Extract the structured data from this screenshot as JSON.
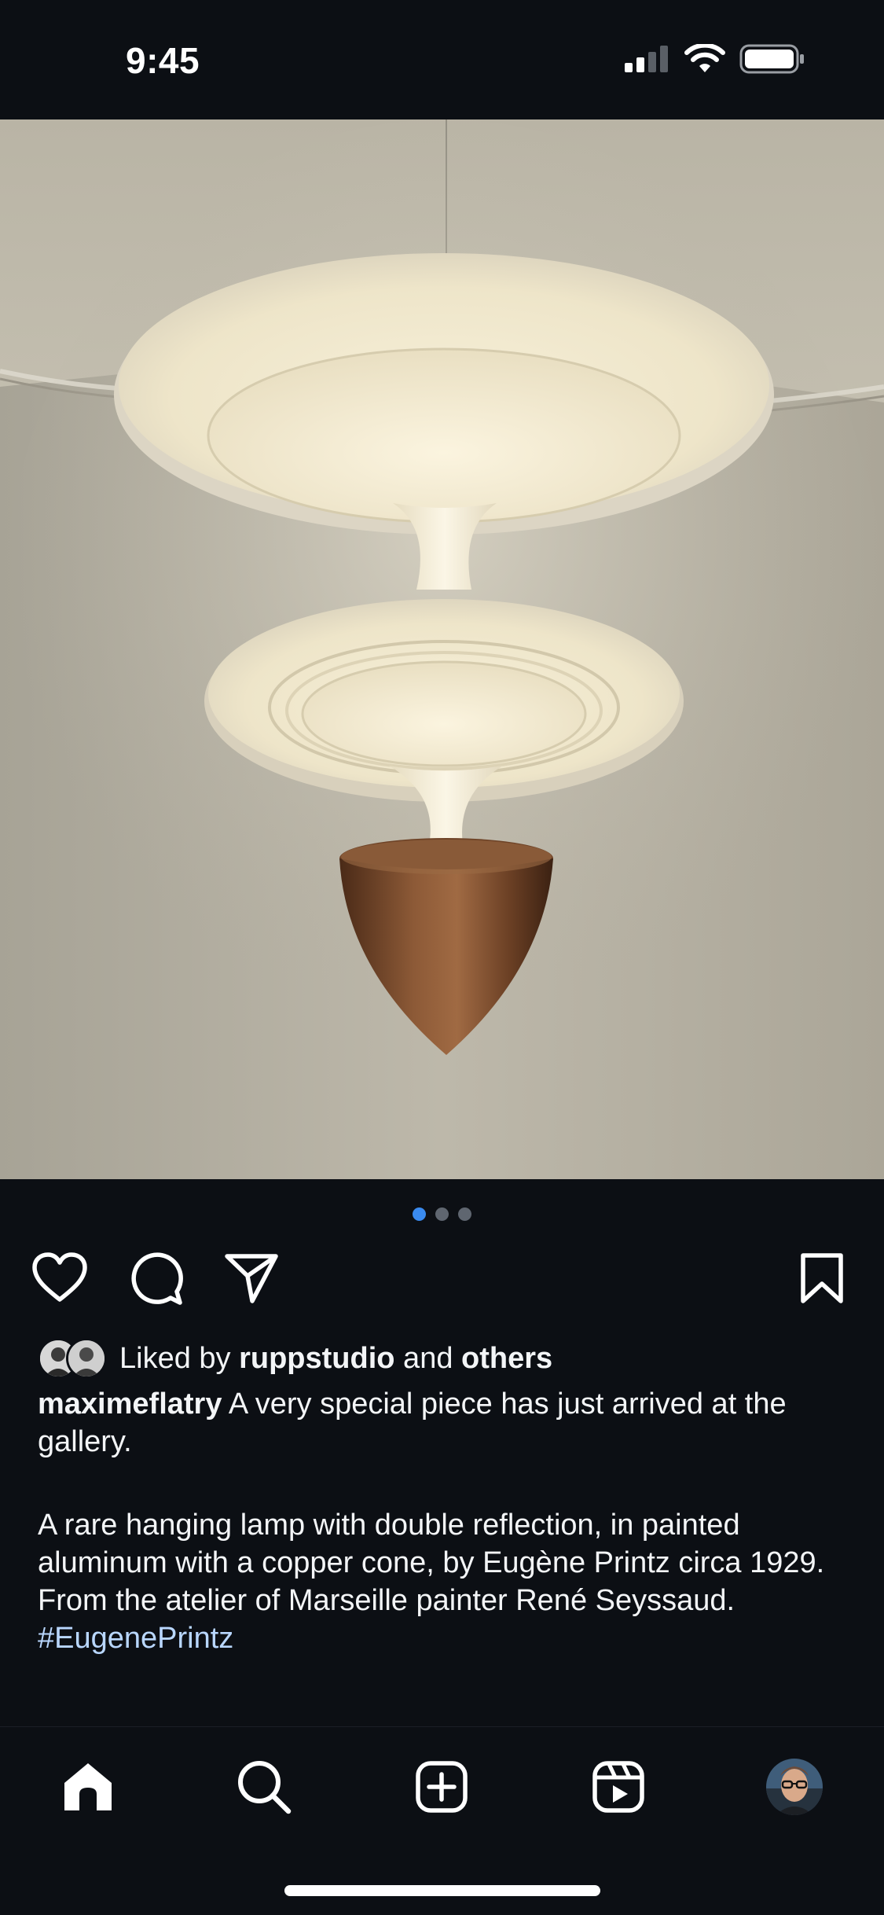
{
  "status_bar": {
    "time": "9:45"
  },
  "post": {
    "carousel": {
      "count": 3,
      "active_index": 0
    },
    "likes": {
      "prefix": "Liked by ",
      "first_user": "ruppstudio",
      "connector": " and ",
      "others": "others"
    },
    "caption": {
      "username": "maximeflatry",
      "line1": " A very special piece has just arrived at the gallery.",
      "para2": "A rare hanging lamp with double reflection, in painted aluminum with a copper cone, by Eugène Printz circa 1929.",
      "para3": "From the atelier of Marseille painter René Seyssaud.",
      "hashtag": "#EugenePrintz"
    }
  },
  "icons": {
    "actions": [
      "heart-icon",
      "comment-icon",
      "share-icon",
      "bookmark-icon"
    ],
    "nav": [
      "home-icon",
      "search-icon",
      "create-icon",
      "reels-icon",
      "profile-avatar"
    ]
  },
  "colors": {
    "background": "#0c0f14",
    "text": "#f3f5f7",
    "hashtag": "#b9d7ff",
    "active_dot": "#3a8bf0",
    "inactive_dot": "#5f6670"
  }
}
